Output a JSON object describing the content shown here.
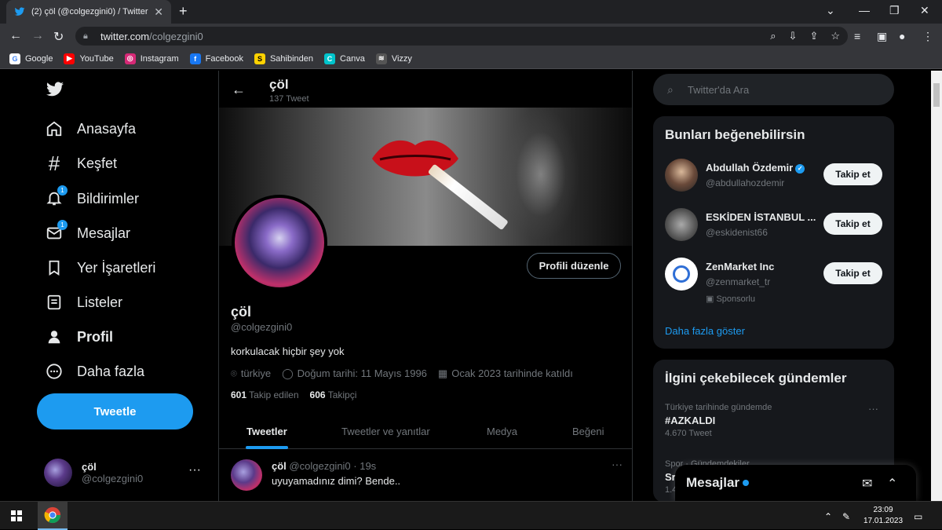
{
  "browser": {
    "tab_title": "(2) çöl (@colgezgini0) / Twitter",
    "tab_close": "✕",
    "new_tab": "+",
    "url_host": "twitter.com",
    "url_path": "/colgezgini0",
    "bookmarks": [
      {
        "label": "Google",
        "color": "#ffffff",
        "glyph": "G"
      },
      {
        "label": "YouTube",
        "color": "#ff0000",
        "glyph": "▶"
      },
      {
        "label": "Instagram",
        "color": "#d62976",
        "glyph": "◎"
      },
      {
        "label": "Facebook",
        "color": "#1877f2",
        "glyph": "f"
      },
      {
        "label": "Sahibinden",
        "color": "#ffd200",
        "glyph": "S"
      },
      {
        "label": "Canva",
        "color": "#00c4cc",
        "glyph": "C"
      },
      {
        "label": "Vizzy",
        "color": "#555555",
        "glyph": "≋"
      }
    ]
  },
  "sidebar": {
    "items": [
      {
        "label": "Anasayfa",
        "icon": "home-icon"
      },
      {
        "label": "Keşfet",
        "icon": "hashtag-icon"
      },
      {
        "label": "Bildirimler",
        "icon": "bell-icon",
        "badge": "1"
      },
      {
        "label": "Mesajlar",
        "icon": "mail-icon",
        "badge": "1"
      },
      {
        "label": "Yer İşaretleri",
        "icon": "bookmark-icon"
      },
      {
        "label": "Listeler",
        "icon": "list-icon"
      },
      {
        "label": "Profil",
        "icon": "person-icon"
      },
      {
        "label": "Daha fazla",
        "icon": "more-circle-icon"
      }
    ],
    "tweet_button": "Tweetle",
    "account_name": "çöl",
    "account_handle": "@colgezgini0",
    "account_more": "···"
  },
  "profile": {
    "header_name": "çöl",
    "tweet_count": "137 Tweet",
    "edit_button": "Profili düzenle",
    "name": "çöl",
    "handle": "@colgezgini0",
    "bio": "korkulacak hiçbir şey yok",
    "location": "türkiye",
    "birthday": "Doğum tarihi: 11 Mayıs 1996",
    "joined": "Ocak 2023 tarihinde katıldı",
    "following_count": "601",
    "following_label": "Takip edilen",
    "followers_count": "606",
    "followers_label": "Takipçi",
    "tabs": [
      "Tweetler",
      "Tweetler ve yanıtlar",
      "Medya",
      "Beğeni"
    ]
  },
  "tweet": {
    "name": "çöl",
    "meta": "@colgezgini0 · 19s",
    "text": "uyuyamadınız dimi? Bende..",
    "more": "···"
  },
  "right": {
    "search_placeholder": "Twitter'da Ara",
    "who_to_follow_title": "Bunları beğenebilirsin",
    "suggestions": [
      {
        "name": "Abdullah Özdemir",
        "handle": "@abdullahozdemir",
        "button": "Takip et",
        "verified": true
      },
      {
        "name": "ESKİDEN İSTANBUL ...",
        "handle": "@eskidenist66",
        "button": "Takip et"
      },
      {
        "name": "ZenMarket Inc",
        "handle": "@zenmarket_tr",
        "button": "Takip et",
        "sponsored": "Sponsorlu"
      }
    ],
    "show_more": "Daha fazla göster",
    "trends_title": "İlgini çekebilecek gündemler",
    "trends": [
      {
        "context": "Türkiye tarihinde gündemde",
        "tag": "#AZKALDI",
        "count": "4.670 Tweet"
      },
      {
        "context": "Spor · Gündemdekiler",
        "tag": "Sr",
        "count": "1.4"
      }
    ],
    "messages_label": "Mesajlar"
  },
  "taskbar": {
    "time": "23:09",
    "date": "17.01.2023"
  }
}
